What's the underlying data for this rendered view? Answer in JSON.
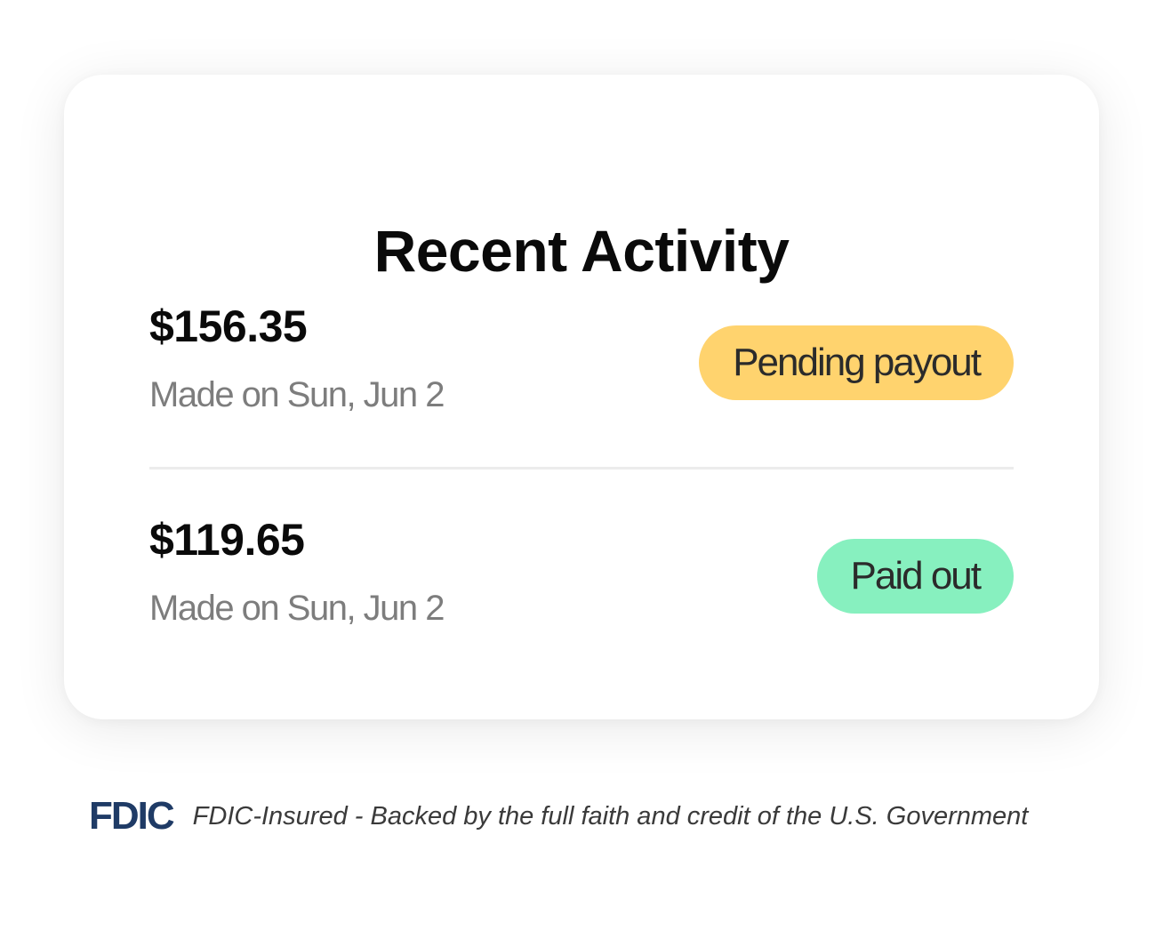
{
  "card": {
    "title": "Recent Activity"
  },
  "activity": [
    {
      "amount": "$156.35",
      "date": "Made on Sun, Jun 2",
      "status": "Pending payout",
      "status_color": "#ffd36e"
    },
    {
      "amount": "$119.65",
      "date": "Made on Sun, Jun 2",
      "status": "Paid out",
      "status_color": "#87f0bf"
    }
  ],
  "footer": {
    "logo_text": "FDIC",
    "logo_color": "#1f3b66",
    "text": "FDIC-Insured - Backed by the full faith and credit of the U.S. Government"
  }
}
